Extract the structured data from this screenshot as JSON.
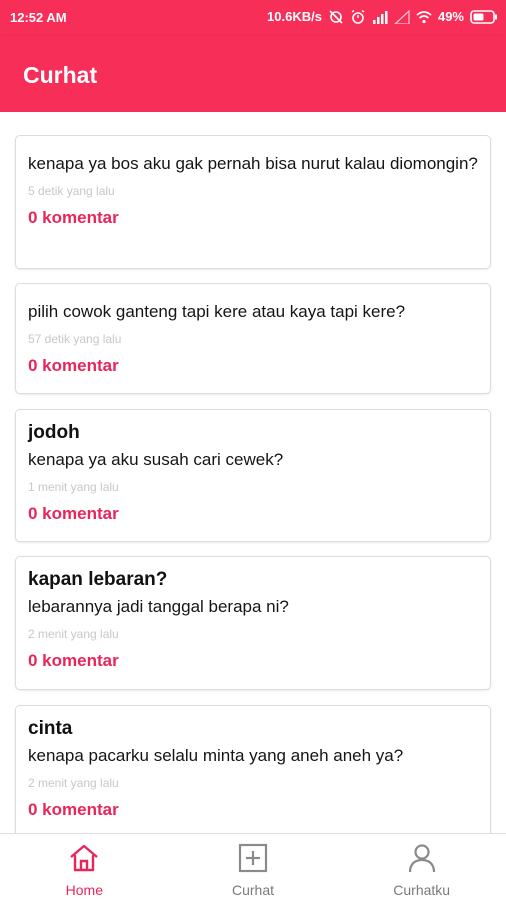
{
  "status_bar": {
    "time": "12:52 AM",
    "network_speed": "10.6KB/s",
    "battery": "49%"
  },
  "app_bar": {
    "title": "Curhat"
  },
  "posts": [
    {
      "title": "",
      "text": "kenapa ya bos aku gak pernah bisa nurut kalau diomongin?",
      "time": "5 detik yang lalu",
      "comments": "0 komentar"
    },
    {
      "title": "",
      "text": "pilih cowok ganteng tapi kere atau kaya tapi kere?",
      "time": "57 detik yang lalu",
      "comments": "0 komentar"
    },
    {
      "title": "jodoh",
      "text": "kenapa ya aku susah cari cewek?",
      "time": "1 menit yang lalu",
      "comments": "0 komentar"
    },
    {
      "title": "kapan lebaran?",
      "text": "lebarannya jadi tanggal berapa ni?",
      "time": "2 menit yang lalu",
      "comments": "0 komentar"
    },
    {
      "title": "cinta",
      "text": "kenapa pacarku selalu minta yang aneh aneh ya?",
      "time": "2 menit yang lalu",
      "comments": "0 komentar"
    }
  ],
  "bottom_nav": [
    {
      "label": "Home",
      "icon": "home-icon",
      "active": true
    },
    {
      "label": "Curhat",
      "icon": "add-box-icon",
      "active": false
    },
    {
      "label": "Curhatku",
      "icon": "person-icon",
      "active": false
    }
  ],
  "colors": {
    "primary": "#f72e57",
    "accent": "#e8265a",
    "muted": "#c7c7c7"
  }
}
